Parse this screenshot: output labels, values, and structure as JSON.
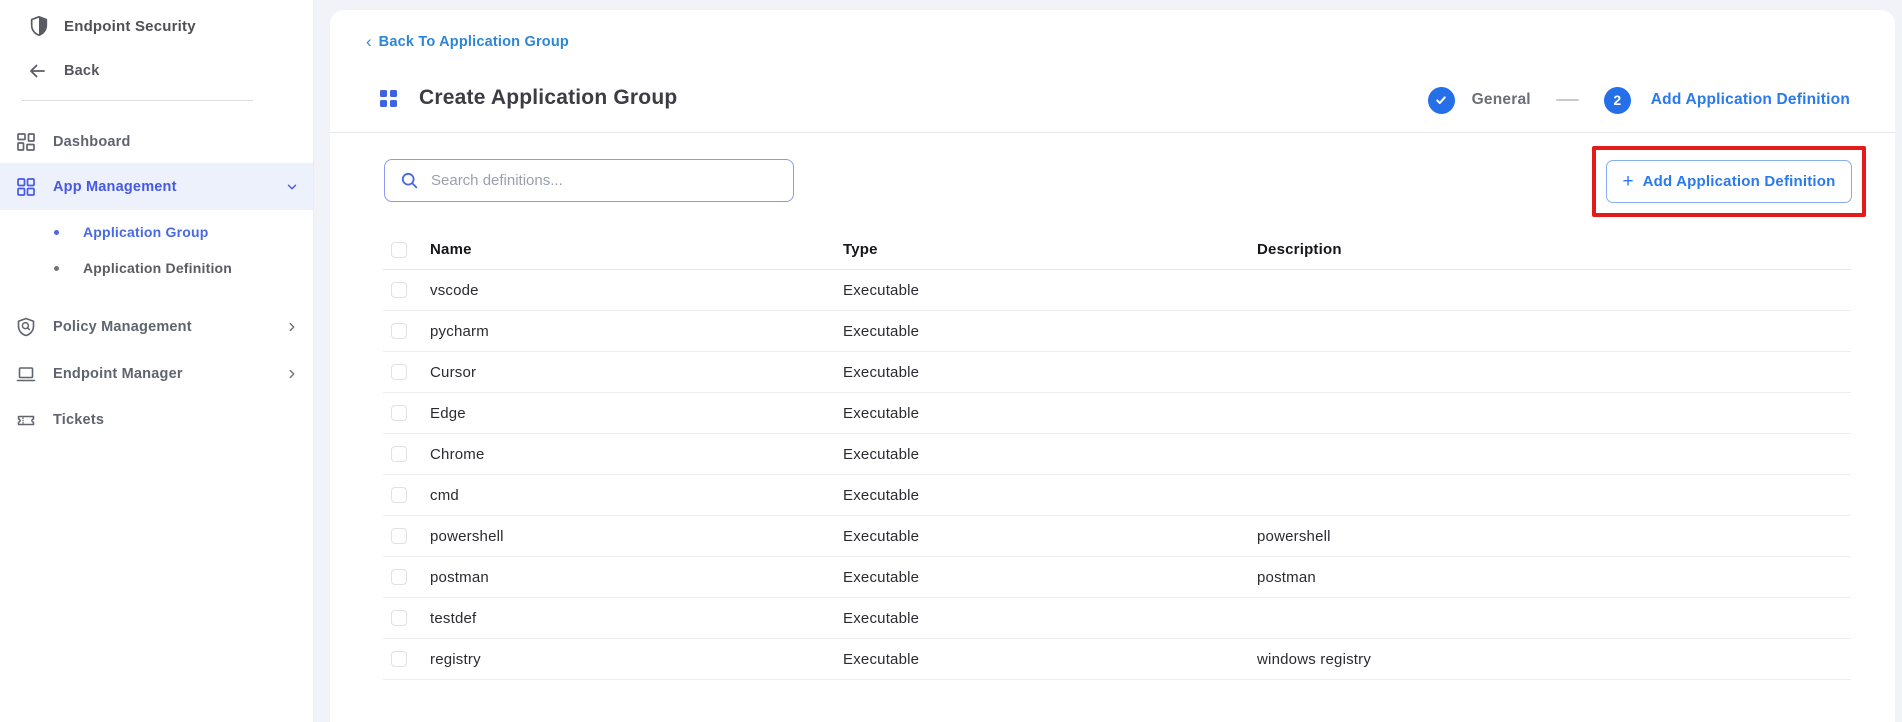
{
  "sidebar": {
    "brand": "Endpoint Security",
    "back_label": "Back",
    "items": [
      {
        "label": "Dashboard"
      },
      {
        "label": "App Management"
      },
      {
        "label": "Application Group"
      },
      {
        "label": "Application Definition"
      },
      {
        "label": "Policy Management"
      },
      {
        "label": "Endpoint Manager"
      },
      {
        "label": "Tickets"
      }
    ]
  },
  "header": {
    "breadcrumb_chevron": "‹",
    "breadcrumb": "Back To Application Group",
    "title": "Create Application Group",
    "stepper": {
      "step1_label": "General",
      "step2_number": "2",
      "step2_label": "Add Application Definition"
    }
  },
  "toolbar": {
    "search_placeholder": "Search definitions...",
    "plus_glyph": "+",
    "add_button_label": "Add Application Definition"
  },
  "table": {
    "columns": [
      "Name",
      "Type",
      "Description"
    ],
    "rows": [
      {
        "name": "vscode",
        "type": "Executable",
        "description": ""
      },
      {
        "name": "pycharm",
        "type": "Executable",
        "description": ""
      },
      {
        "name": "Cursor",
        "type": "Executable",
        "description": ""
      },
      {
        "name": "Edge",
        "type": "Executable",
        "description": ""
      },
      {
        "name": "Chrome",
        "type": "Executable",
        "description": ""
      },
      {
        "name": "cmd",
        "type": "Executable",
        "description": ""
      },
      {
        "name": "powershell",
        "type": "Executable",
        "description": "powershell"
      },
      {
        "name": "postman",
        "type": "Executable",
        "description": "postman"
      },
      {
        "name": "testdef",
        "type": "Executable",
        "description": ""
      },
      {
        "name": "registry",
        "type": "Executable",
        "description": "windows registry"
      }
    ]
  },
  "colors": {
    "accent_indigo": "#4759e4",
    "accent_blue": "#2979ef",
    "link_blue": "#2d86d5",
    "annotation_red": "#e31b1b",
    "active_item_bg": "#edf1fb",
    "page_bg": "#f1f3f8"
  }
}
